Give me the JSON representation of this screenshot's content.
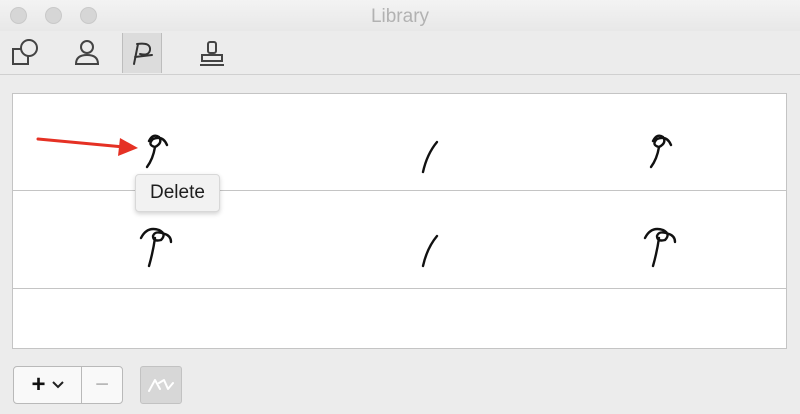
{
  "window": {
    "title": "Library",
    "traffic_lights": [
      "close",
      "minimize",
      "zoom"
    ]
  },
  "toolbar": {
    "tabs": [
      {
        "icon": "shapes-icon",
        "active": false
      },
      {
        "icon": "person-icon",
        "active": false
      },
      {
        "icon": "signature-icon",
        "active": true
      },
      {
        "icon": "stamp-icon",
        "active": false
      }
    ]
  },
  "library": {
    "rows": [
      {
        "cells": [
          "signature-loop",
          "signature-slash",
          "signature-loop"
        ]
      },
      {
        "cells": [
          "signature-hook",
          "signature-slash",
          "signature-hook"
        ]
      },
      {
        "cells": []
      }
    ]
  },
  "tooltip": {
    "text": "Delete"
  },
  "annotation": {
    "arrow_color": "#e53124"
  },
  "footer": {
    "add_label": "+",
    "remove_label": "−",
    "extra_icon": "signature-preview-icon"
  }
}
